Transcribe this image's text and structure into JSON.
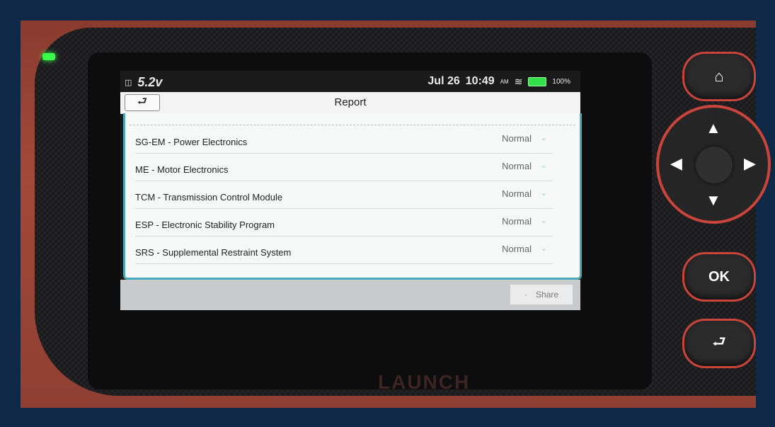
{
  "status_bar": {
    "voltage": "5.2v",
    "date": "Jul 26",
    "time": "10:49",
    "ampm": "AM",
    "battery_pct": "100%"
  },
  "header": {
    "title": "Report"
  },
  "systems": [
    {
      "name": "SG-EM - Power Electronics",
      "status": "Normal"
    },
    {
      "name": "ME - Motor Electronics",
      "status": "Normal"
    },
    {
      "name": "TCM - Transmission Control Module",
      "status": "Normal"
    },
    {
      "name": "ESP - Electronic Stability Program",
      "status": "Normal"
    },
    {
      "name": "SRS - Supplemental Restraint System",
      "status": "Normal"
    }
  ],
  "footer": {
    "share_label": "Share"
  },
  "device": {
    "brand": "LAUNCH",
    "ok_label": "OK"
  },
  "colors": {
    "accent": "#4aa8b7",
    "device_red": "#c9443a",
    "led": "#39ff4a"
  }
}
